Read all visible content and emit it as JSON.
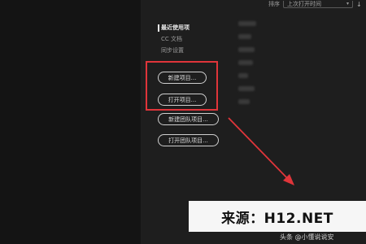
{
  "toolbar": {
    "sort_label": "排序",
    "sort_value": "上次打开时间",
    "sort_direction_icon": "arrow-down-icon"
  },
  "nav": {
    "items": [
      {
        "label": "最近使用项"
      },
      {
        "label": "CC 文档"
      },
      {
        "label": "同步设置"
      }
    ]
  },
  "buttons": {
    "new_project": "新建项目...",
    "open_project": "打开项目...",
    "new_team_project": "新建团队项目...",
    "open_team_project": "打开团队项目..."
  },
  "annotation": {
    "highlight_color": "#e0353a"
  },
  "watermark": {
    "text": "来源：H12.NET",
    "attribution": "头条 @小懂说说安"
  }
}
